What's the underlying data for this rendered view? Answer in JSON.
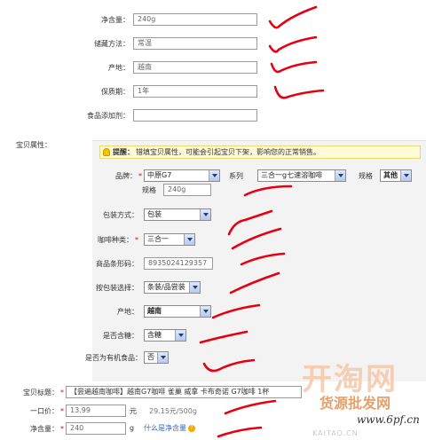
{
  "top_fields": [
    {
      "label": "净含量：",
      "value": "240g"
    },
    {
      "label": "储藏方法：",
      "value": "常温"
    },
    {
      "label": "产地：",
      "value": "越南"
    },
    {
      "label": "保质期：",
      "value": "1年"
    },
    {
      "label": "食品添加剂：",
      "value": ""
    }
  ],
  "attributes": {
    "section_label": "宝贝属性：",
    "tip_bold": "提醒：",
    "tip_text": "错填宝贝属性，可能会引起宝贝下架，影响您的正常销售。",
    "brand_label": "品牌：",
    "brand_value": "中原G7",
    "series_label": "系列",
    "series_value": "三合一g七速溶咖啡",
    "spec_label": "规格",
    "spec_value": "其他",
    "spec2_label": "规格",
    "spec2_value": "240g",
    "packaging_label": "包装方式：",
    "packaging_value": "包装",
    "coffee_type_label": "咖啡种类：",
    "coffee_type_value": "三合一",
    "barcode_label": "商品条形码：",
    "barcode_value": "8935024129357",
    "package_select_label": "按包装选择：",
    "package_select_value": "条装/品尝装",
    "origin_label": "产地：",
    "origin_value": "越南",
    "sugar_label": "是否含糖：",
    "sugar_value": "含糖",
    "organic_label": "是否为有机食品：",
    "organic_value": "否"
  },
  "bottom": {
    "title_label": "宝贝标题：",
    "title_value": "【尝遍越南咖啡】越南G7咖啡 雀巢 威拿 卡布奇诺 G7咖啡 1杯",
    "price_label": "一口价：",
    "price_value": "13.99",
    "price_unit": "元",
    "unit_price": "29.15元/500g",
    "net_label": "净含量：",
    "net_value": "240",
    "net_unit": "g",
    "net_help": "什么是净含量",
    "help_icon_text": "?"
  },
  "watermark": {
    "logo": "开淘网",
    "line2": "货源批发网",
    "line3": "www.6pf.cn",
    "line4": "KAITAO.CN"
  },
  "colors": {
    "tick": "#e60012",
    "required": "#ee0000",
    "tip_bg": "#fffbd6"
  }
}
